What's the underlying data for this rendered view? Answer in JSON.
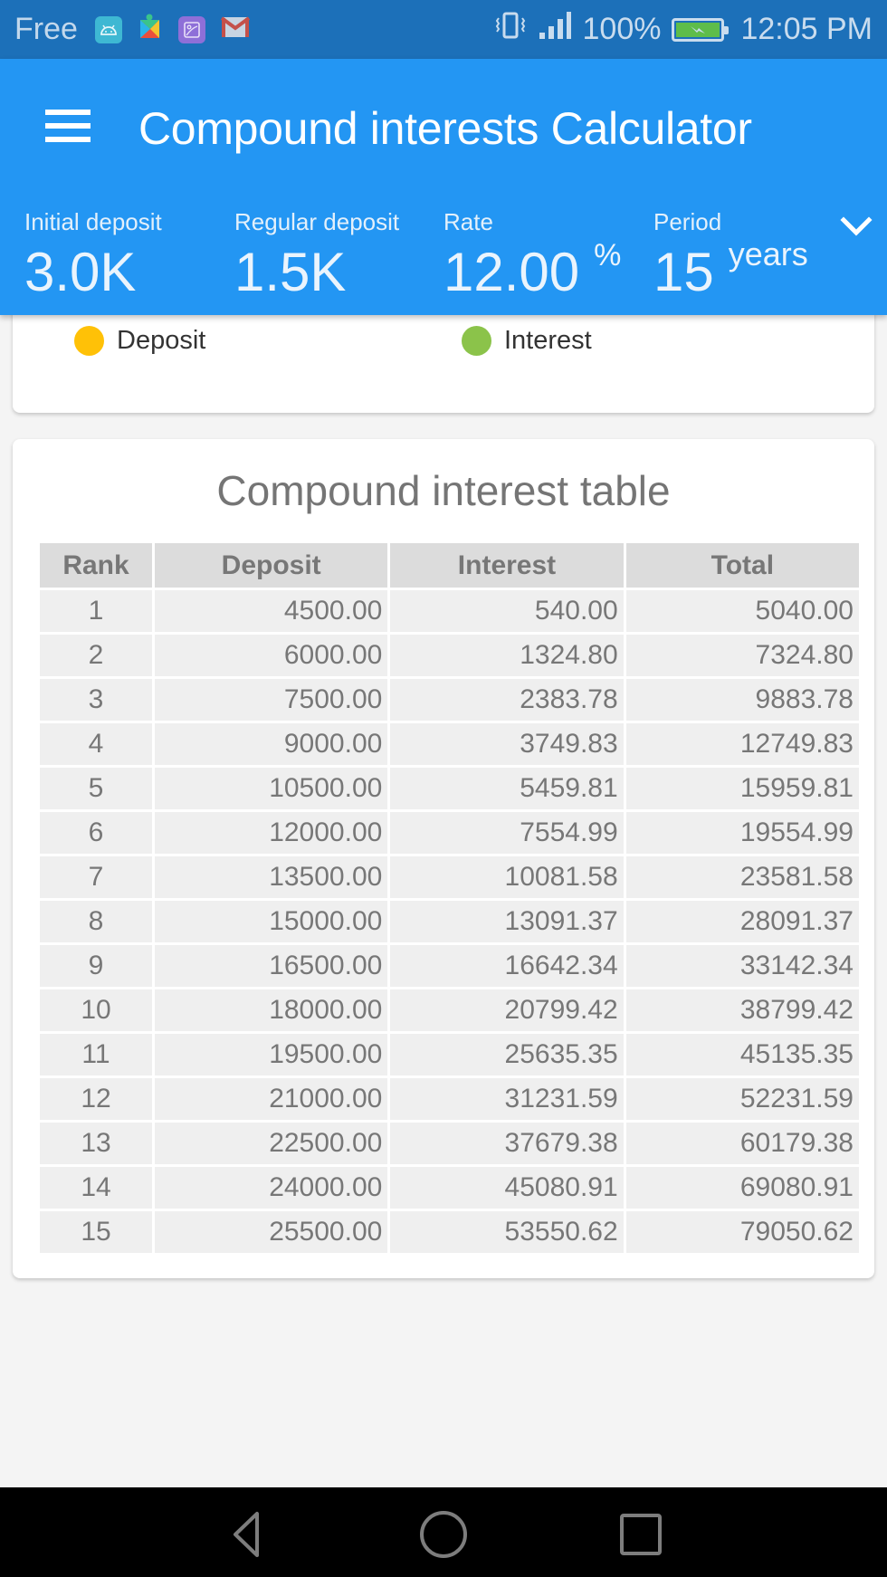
{
  "status_bar": {
    "carrier": "Free",
    "notification_icons": [
      "android-icon",
      "play-services-icon",
      "gallery-icon",
      "gmail-icon"
    ],
    "battery_percent": "100%",
    "time": "12:05 PM"
  },
  "app_bar": {
    "title": "Compound interests Calculator",
    "params": {
      "initial_deposit": {
        "label": "Initial deposit",
        "value": "3.0K"
      },
      "regular_deposit": {
        "label": "Regular deposit",
        "value": "1.5K"
      },
      "rate": {
        "label": "Rate",
        "value": "12.00",
        "unit": "%"
      },
      "period": {
        "label": "Period",
        "value": "15",
        "unit": "years"
      }
    }
  },
  "legend": {
    "items": [
      {
        "label": "Deposit",
        "color": "#ffc107"
      },
      {
        "label": "Interest",
        "color": "#8bc34a"
      }
    ]
  },
  "table": {
    "title": "Compound interest table",
    "columns": [
      "Rank",
      "Deposit",
      "Interest",
      "Total"
    ],
    "rows": [
      [
        "1",
        "4500.00",
        "540.00",
        "5040.00"
      ],
      [
        "2",
        "6000.00",
        "1324.80",
        "7324.80"
      ],
      [
        "3",
        "7500.00",
        "2383.78",
        "9883.78"
      ],
      [
        "4",
        "9000.00",
        "3749.83",
        "12749.83"
      ],
      [
        "5",
        "10500.00",
        "5459.81",
        "15959.81"
      ],
      [
        "6",
        "12000.00",
        "7554.99",
        "19554.99"
      ],
      [
        "7",
        "13500.00",
        "10081.58",
        "23581.58"
      ],
      [
        "8",
        "15000.00",
        "13091.37",
        "28091.37"
      ],
      [
        "9",
        "16500.00",
        "16642.34",
        "33142.34"
      ],
      [
        "10",
        "18000.00",
        "20799.42",
        "38799.42"
      ],
      [
        "11",
        "19500.00",
        "25635.35",
        "45135.35"
      ],
      [
        "12",
        "21000.00",
        "31231.59",
        "52231.59"
      ],
      [
        "13",
        "22500.00",
        "37679.38",
        "60179.38"
      ],
      [
        "14",
        "24000.00",
        "45080.91",
        "69080.91"
      ],
      [
        "15",
        "25500.00",
        "53550.62",
        "79050.62"
      ]
    ]
  },
  "colors": {
    "status_bar": "#1c70b9",
    "app_bar": "#2396f3",
    "background": "#f4f4f4"
  }
}
